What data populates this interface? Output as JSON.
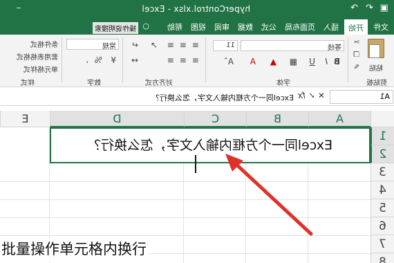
{
  "window": {
    "title": "hyperControl.xlsx - Excel"
  },
  "ribbon_tabs": [
    {
      "label": "文件"
    },
    {
      "label": "开始"
    },
    {
      "label": "插入"
    },
    {
      "label": "页面布局"
    },
    {
      "label": "公式"
    },
    {
      "label": "数据"
    },
    {
      "label": "审阅"
    },
    {
      "label": "视图"
    },
    {
      "label": "帮助"
    }
  ],
  "tell_me": {
    "label": "操作说明搜索"
  },
  "ribbon": {
    "groups": {
      "clipboard": "剪贴板",
      "font": "字体",
      "alignment": "对齐方式",
      "number": "数字",
      "styles": "样式"
    },
    "paste_label": "粘贴",
    "font_name": "等线",
    "font_size": "11",
    "number_format": "常规",
    "styles_items": [
      "条件格式",
      "套用表格格式",
      "单元格样式"
    ],
    "bold": "B",
    "italic": "I",
    "underline": "U"
  },
  "formula_bar": {
    "name_box": "A1",
    "fx": "fx",
    "content": "Excel同一个方框内输入文字，怎么换行？"
  },
  "columns": [
    "A",
    "B",
    "C",
    "D",
    "E"
  ],
  "rows": [
    "1",
    "2",
    "3",
    "4",
    "5",
    "6",
    "7",
    "8"
  ],
  "cell_text": "Excel同一个方框内输入文字，怎么换行？",
  "caption": "批量操作单元格内换行",
  "colors": {
    "excel_green": "#217346",
    "arrow": "#e0302a"
  }
}
